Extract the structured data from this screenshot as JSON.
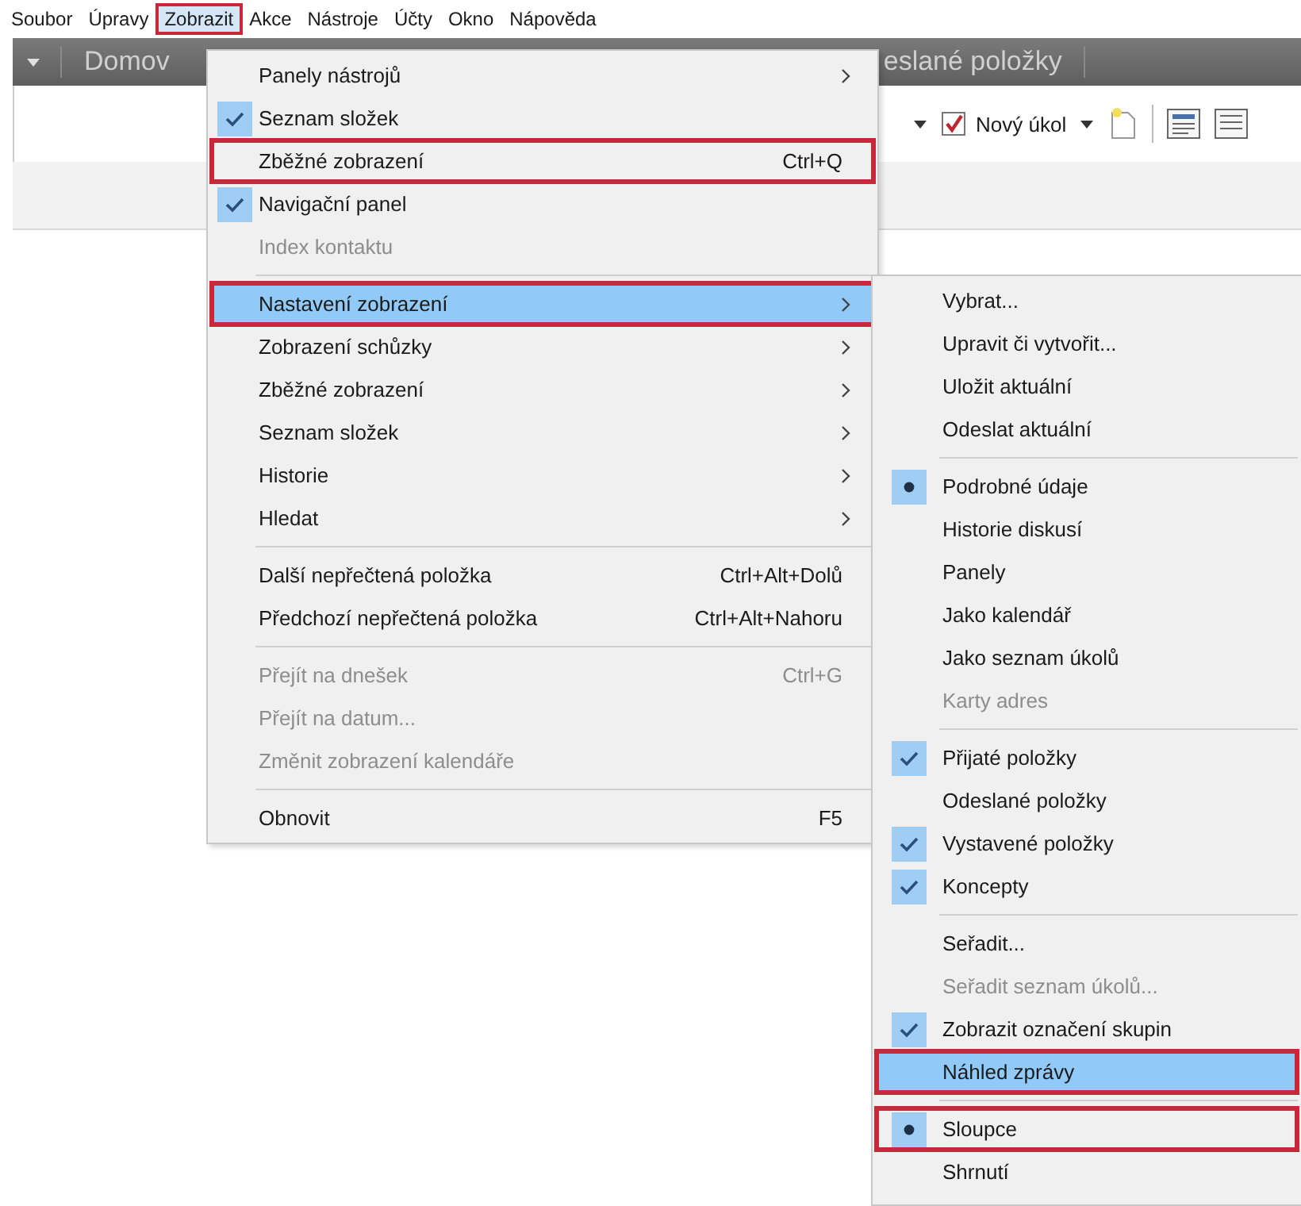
{
  "menu_bar": [
    {
      "label": "Soubor",
      "selected": false,
      "annotated": false
    },
    {
      "label": "Úpravy",
      "selected": false,
      "annotated": false
    },
    {
      "label": "Zobrazit",
      "selected": true,
      "annotated": true
    },
    {
      "label": "Akce",
      "selected": false,
      "annotated": false
    },
    {
      "label": "Nástroje",
      "selected": false,
      "annotated": false
    },
    {
      "label": "Účty",
      "selected": false,
      "annotated": false
    },
    {
      "label": "Okno",
      "selected": false,
      "annotated": false
    },
    {
      "label": "Nápověda",
      "selected": false,
      "annotated": false
    }
  ],
  "ribbon_tabs": [
    {
      "label": "Domov"
    },
    {
      "label": "eslané položky"
    }
  ],
  "toolbar": {
    "new_task_label": "Nový úkol"
  },
  "view_menu": [
    {
      "kind": "plain",
      "label": "Panely nástrojů",
      "submenu": true,
      "selected": false,
      "disabled": false,
      "annotated": false
    },
    {
      "kind": "check",
      "label": "Seznam složek",
      "checked": true,
      "selected": false,
      "disabled": false,
      "annotated": false
    },
    {
      "kind": "plain",
      "label": "Zběžné zobrazení",
      "shortcut": "Ctrl+Q",
      "selected": false,
      "disabled": false,
      "annotated": true
    },
    {
      "kind": "check",
      "label": "Navigační panel",
      "checked": true,
      "selected": false,
      "disabled": false,
      "annotated": false
    },
    {
      "kind": "plain",
      "label": "Index kontaktu",
      "selected": false,
      "disabled": true,
      "annotated": false
    },
    {
      "kind": "separator"
    },
    {
      "kind": "plain",
      "label": "Nastavení zobrazení",
      "submenu": true,
      "selected": true,
      "disabled": false,
      "annotated": true
    },
    {
      "kind": "plain",
      "label": "Zobrazení schůzky",
      "submenu": true,
      "selected": false,
      "disabled": false,
      "annotated": false
    },
    {
      "kind": "plain",
      "label": "Zběžné zobrazení",
      "submenu": true,
      "selected": false,
      "disabled": false,
      "annotated": false
    },
    {
      "kind": "plain",
      "label": "Seznam složek",
      "submenu": true,
      "selected": false,
      "disabled": false,
      "annotated": false
    },
    {
      "kind": "plain",
      "label": "Historie",
      "submenu": true,
      "selected": false,
      "disabled": false,
      "annotated": false
    },
    {
      "kind": "plain",
      "label": "Hledat",
      "submenu": true,
      "selected": false,
      "disabled": false,
      "annotated": false
    },
    {
      "kind": "separator"
    },
    {
      "kind": "plain",
      "label": "Další nepřečtená položka",
      "shortcut": "Ctrl+Alt+Dolů",
      "selected": false,
      "disabled": false,
      "annotated": false
    },
    {
      "kind": "plain",
      "label": "Předchozí nepřečtená položka",
      "shortcut": "Ctrl+Alt+Nahoru",
      "selected": false,
      "disabled": false,
      "annotated": false
    },
    {
      "kind": "separator"
    },
    {
      "kind": "plain",
      "label": "Přejít na dnešek",
      "shortcut": "Ctrl+G",
      "selected": false,
      "disabled": true,
      "annotated": false
    },
    {
      "kind": "plain",
      "label": "Přejít na datum...",
      "selected": false,
      "disabled": true,
      "annotated": false
    },
    {
      "kind": "plain",
      "label": "Změnit zobrazení kalendáře",
      "selected": false,
      "disabled": true,
      "annotated": false
    },
    {
      "kind": "separator"
    },
    {
      "kind": "plain",
      "label": "Obnovit",
      "shortcut": "F5",
      "selected": false,
      "disabled": false,
      "annotated": false
    }
  ],
  "view_settings_submenu": [
    {
      "kind": "plain",
      "label": "Vybrat...",
      "selected": false,
      "disabled": false,
      "annotated": false
    },
    {
      "kind": "plain",
      "label": "Upravit či vytvořit...",
      "selected": false,
      "disabled": false,
      "annotated": false
    },
    {
      "kind": "plain",
      "label": "Uložit aktuální",
      "selected": false,
      "disabled": false,
      "annotated": false
    },
    {
      "kind": "plain",
      "label": "Odeslat aktuální",
      "selected": false,
      "disabled": false,
      "annotated": false
    },
    {
      "kind": "separator"
    },
    {
      "kind": "radio",
      "label": "Podrobné údaje",
      "checked": true,
      "selected": false,
      "disabled": false,
      "annotated": false
    },
    {
      "kind": "radio",
      "label": "Historie diskusí",
      "checked": false,
      "selected": false,
      "disabled": false,
      "annotated": false
    },
    {
      "kind": "radio",
      "label": "Panely",
      "checked": false,
      "selected": false,
      "disabled": false,
      "annotated": false
    },
    {
      "kind": "radio",
      "label": "Jako kalendář",
      "checked": false,
      "selected": false,
      "disabled": false,
      "annotated": false
    },
    {
      "kind": "radio",
      "label": "Jako seznam úkolů",
      "checked": false,
      "selected": false,
      "disabled": false,
      "annotated": false
    },
    {
      "kind": "radio",
      "label": "Karty adres",
      "checked": false,
      "selected": false,
      "disabled": true,
      "annotated": false
    },
    {
      "kind": "separator"
    },
    {
      "kind": "check",
      "label": "Přijaté položky",
      "checked": true,
      "selected": false,
      "disabled": false,
      "annotated": false
    },
    {
      "kind": "check",
      "label": "Odeslané položky",
      "checked": false,
      "selected": false,
      "disabled": false,
      "annotated": false
    },
    {
      "kind": "check",
      "label": "Vystavené položky",
      "checked": true,
      "selected": false,
      "disabled": false,
      "annotated": false
    },
    {
      "kind": "check",
      "label": "Koncepty",
      "checked": true,
      "selected": false,
      "disabled": false,
      "annotated": false
    },
    {
      "kind": "separator"
    },
    {
      "kind": "plain",
      "label": "Seřadit...",
      "selected": false,
      "disabled": false,
      "annotated": false
    },
    {
      "kind": "plain",
      "label": "Seřadit seznam úkolů...",
      "selected": false,
      "disabled": true,
      "annotated": false
    },
    {
      "kind": "check",
      "label": "Zobrazit označení skupin",
      "checked": true,
      "selected": false,
      "disabled": false,
      "annotated": false
    },
    {
      "kind": "check",
      "label": "Náhled zprávy",
      "checked": false,
      "selected": true,
      "disabled": false,
      "annotated": true
    },
    {
      "kind": "separator"
    },
    {
      "kind": "radio",
      "label": "Sloupce",
      "checked": true,
      "selected": false,
      "disabled": false,
      "annotated": true
    },
    {
      "kind": "radio",
      "label": "Shrnutí",
      "checked": false,
      "selected": false,
      "disabled": false,
      "annotated": false
    }
  ]
}
